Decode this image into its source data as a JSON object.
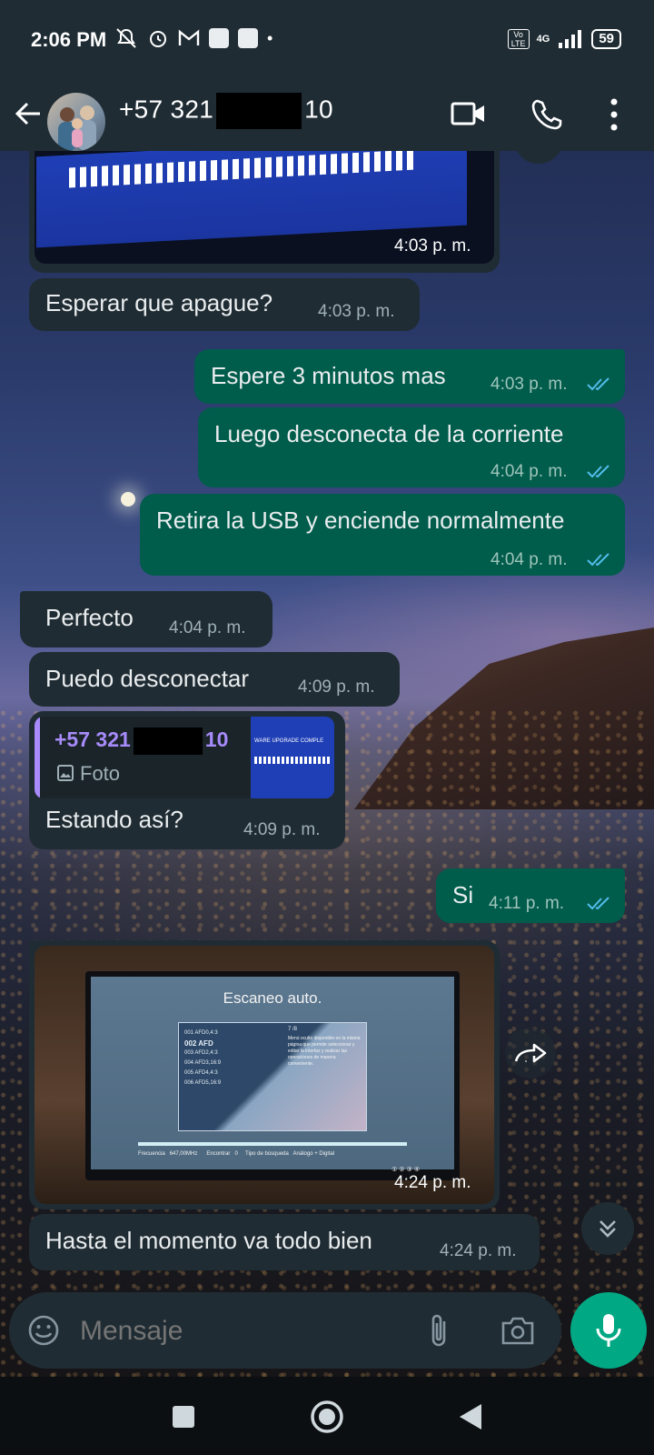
{
  "status_bar": {
    "time": "2:06 PM",
    "network": "4G",
    "volte": "Vo LTE",
    "battery": "59"
  },
  "header": {
    "contact_prefix": "+57 321",
    "contact_suffix": "10"
  },
  "messages": {
    "m1_time": "4:03 p. m.",
    "m2_text": "Esperar que apague?",
    "m2_time": "4:03 p. m.",
    "m3_text": "Espere 3 minutos mas",
    "m3_time": "4:03 p. m.",
    "m4_text": "Luego desconecta de la corriente",
    "m4_time": "4:04 p. m.",
    "m5_text": "Retira la USB y enciende normalmente",
    "m5_time": "4:04 p. m.",
    "m6_text": "Perfecto",
    "m6_time": "4:04 p. m.",
    "m7_text": "Puedo desconectar",
    "m7_time": "4:09 p. m.",
    "m8_quote_name_prefix": "+57 321",
    "m8_quote_name_suffix": "10",
    "m8_quote_type": "Foto",
    "m8_quote_thumb_text": "WARE UPGRADE COMPLE",
    "m8_text": "Estando así?",
    "m8_time": "4:09 p. m.",
    "m9_text": "Si",
    "m9_time": "4:11 p. m.",
    "m10_time": "4:24 p. m.",
    "m11_text": "Hasta el momento va todo bien",
    "m11_time": "4:24 p. m."
  },
  "tv_screen": {
    "title": "Escaneo auto.",
    "channels": [
      "001 AFD0,4:3",
      "002 AFD",
      "003 AFD2,4:3",
      "004 AFD3,16:9",
      "005 AFD4,4:3",
      "006 AFD5,16:9"
    ],
    "panel_num": "7 /8",
    "panel_desc": "Menú oculto disponible en la misma página que permite seleccionar y editar la interfaz y realizar las operaciones de manera conveniente.",
    "freq_label": "Frecuencia",
    "freq_value": "647,00MHz",
    "found_label": "Encontrar",
    "found_value": "0",
    "search_label": "Tipo de búsqueda",
    "search_value": "Análogo + Digital",
    "steps": "① ② ③ ④"
  },
  "composer": {
    "placeholder": "Mensaje"
  },
  "icons": {
    "back": "arrow-left-icon",
    "video": "video-call-icon",
    "call": "phone-icon",
    "menu": "more-vert-icon",
    "emoji": "emoji-icon",
    "attach": "paperclip-icon",
    "camera": "camera-icon",
    "mic": "mic-icon",
    "forward": "forward-icon",
    "scroll": "double-chevron-down-icon"
  },
  "colors": {
    "header_bg": "#1f2c34",
    "incoming_bubble": "#202c33",
    "outgoing_bubble": "#005c4b",
    "accent": "#00a884",
    "read_ticks": "#53bdeb",
    "quote_accent": "#a78bfa"
  }
}
